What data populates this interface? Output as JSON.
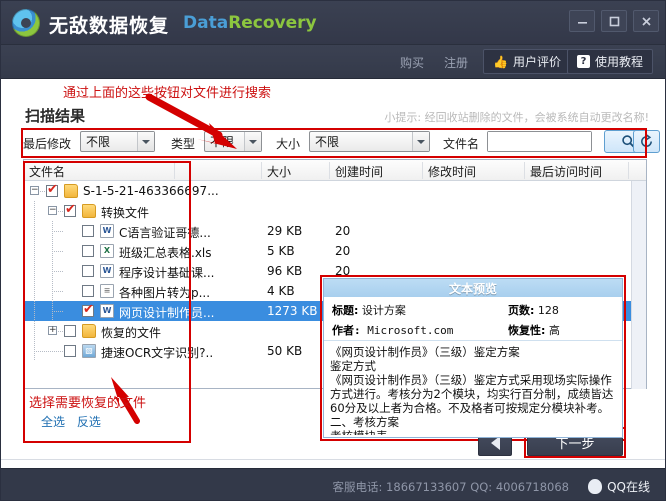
{
  "window": {
    "title_cn": "无敌数据恢复",
    "title_en_1": "Data",
    "title_en_2": "Recovery",
    "logo_icon": "recovery-logo-icon",
    "minimize_label": "最小化",
    "maximize_label": "最大化",
    "close_label": "关闭"
  },
  "toolbar": {
    "buy_label": "购买",
    "register_label": "注册",
    "rate_label": "用户评价",
    "rate_icon": "thumbs-up-icon",
    "help_label": "使用教程",
    "help_icon": "question-mark-icon"
  },
  "annotations": {
    "top": "通过上面的这些按钮对文件进行搜索",
    "bottom": "选择需要恢复的文件",
    "box_color": "#d40000"
  },
  "page": {
    "section_title": "扫描结果",
    "hint": "小提示: 经回收站删除的文件，会被系统自动更改名称!"
  },
  "filter": {
    "modified_label": "最后修改",
    "modified_value": "不限",
    "type_label": "类型",
    "type_value": "不限",
    "size_label": "大小",
    "size_value": "不限",
    "filename_label": "文件名",
    "filename_value": "",
    "filename_placeholder": "",
    "search_icon": "search-icon",
    "reset_icon": "refresh-icon",
    "options": [
      "不限"
    ]
  },
  "filelist": {
    "columns": [
      "文件名",
      "大小",
      "创建时间",
      "修改时间",
      "最后访问时间"
    ],
    "rows": [
      {
        "name": "S-1-5-21-463366697...",
        "size": "",
        "created": "",
        "modified": "",
        "accessed": "",
        "icon": "folder-icon",
        "checked": true,
        "level": 0,
        "expander": "collapse",
        "selected": false
      },
      {
        "name": "转换文件",
        "size": "",
        "created": "",
        "modified": "",
        "accessed": "",
        "icon": "folder-icon",
        "checked": true,
        "level": 1,
        "expander": "collapse",
        "selected": false
      },
      {
        "name": "C语言验证哥德...",
        "size": "29 KB",
        "created": "20",
        "modified": "",
        "accessed": "",
        "icon": "word-doc-icon",
        "checked": false,
        "level": 2,
        "expander": "none",
        "selected": false
      },
      {
        "name": "班级汇总表格.xls",
        "size": "5 KB",
        "created": "20",
        "modified": "",
        "accessed": "",
        "icon": "excel-doc-icon",
        "checked": false,
        "level": 2,
        "expander": "none",
        "selected": false
      },
      {
        "name": "程序设计基础课...",
        "size": "96 KB",
        "created": "20",
        "modified": "",
        "accessed": "",
        "icon": "word-doc-icon",
        "checked": false,
        "level": 2,
        "expander": "none",
        "selected": false
      },
      {
        "name": "各种图片转为p...",
        "size": "4 KB",
        "created": "20",
        "modified": "",
        "accessed": "",
        "icon": "text-doc-icon",
        "checked": false,
        "level": 2,
        "expander": "none",
        "selected": false
      },
      {
        "name": "网页设计制作员...",
        "size": "1273 KB",
        "created": "20",
        "modified": "",
        "accessed": "",
        "icon": "word-doc-icon",
        "checked": true,
        "level": 2,
        "expander": "none",
        "selected": true
      },
      {
        "name": "恢复的文件",
        "size": "",
        "created": "",
        "modified": "",
        "accessed": "",
        "icon": "folder-icon",
        "checked": false,
        "level": 1,
        "expander": "expand",
        "selected": false
      },
      {
        "name": "捷速OCR文字识别?..",
        "size": "50 KB",
        "created": "20",
        "modified": "",
        "accessed": "",
        "icon": "image-doc-icon",
        "checked": false,
        "level": 1,
        "expander": "none",
        "selected": false
      }
    ]
  },
  "preview": {
    "title": "文本预览",
    "title_label": "标题:",
    "title_value": "设计方案",
    "author_label": "作者:",
    "author_value": "Microsoft.com",
    "pages_label": "页数:",
    "pages_value": "128",
    "recoverability_label": "恢复性:",
    "recoverability_value": "高",
    "text": "《网页设计制作员》（三级）鉴定方案\n鉴定方式\n《网页设计制作员》（三级）鉴定方式采用现场实际操作方式进行。考核分为2个模块，均实行百分制，成绩皆达60分及以上者为合格。不及格者可按规定分模块补考。\n二、考核方案\n考核模块表\n职业（工种）•网页设计制作员•等级•一　二　三　四　五　其它"
  },
  "selection": {
    "select_all": "全选",
    "invert": "反选"
  },
  "nav": {
    "prev_icon": "triangle-left-icon",
    "next_label": "下一步"
  },
  "statusbar": {
    "text": "客服电话: 18667133607  QQ: 4006718068",
    "qq_label": "QQ在线",
    "qq_icon": "qq-penguin-icon"
  }
}
